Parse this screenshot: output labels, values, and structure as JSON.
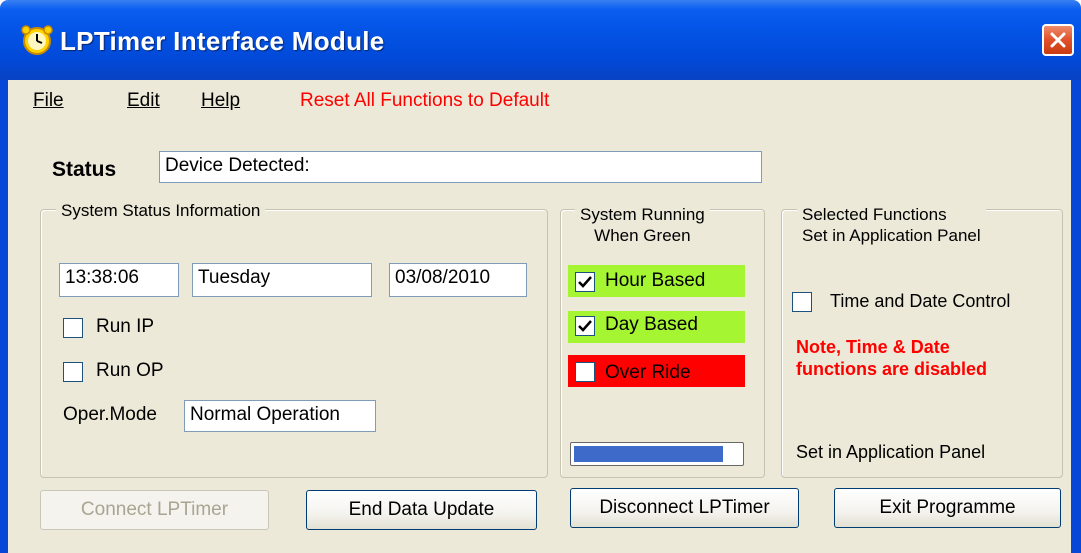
{
  "window": {
    "title": "LPTimer Interface Module"
  },
  "menu": {
    "file": "File",
    "edit": "Edit",
    "help": "Help",
    "reset": "Reset All Functions to Default"
  },
  "status": {
    "label": "Status",
    "value": "Device Detected:"
  },
  "system_status": {
    "title": "System Status Information",
    "time": "13:38:06",
    "day": "Tuesday",
    "date": "03/08/2010",
    "run_ip": {
      "label": "Run IP",
      "checked": false
    },
    "run_op": {
      "label": "Run OP",
      "checked": false
    },
    "oper_mode_label": "Oper.Mode",
    "oper_mode_value": "Normal Operation"
  },
  "system_running": {
    "title_line1": "System Running",
    "title_line2": "When Green",
    "hour_based": {
      "label": "Hour Based",
      "checked": true,
      "color": "#a6f532"
    },
    "day_based": {
      "label": "Day Based",
      "checked": true,
      "color": "#a6f532"
    },
    "over_ride": {
      "label": "Over Ride",
      "checked": false,
      "color": "#ff0000"
    },
    "progress": 0.9
  },
  "selected_functions": {
    "title_line1": "Selected Functions",
    "title_line2": "Set in Application Panel",
    "time_date_control": {
      "label": "Time and Date Control",
      "checked": false
    },
    "note_line1": "Note, Time & Date",
    "note_line2": "functions are disabled",
    "footer": "Set in Application Panel"
  },
  "buttons": {
    "connect": "Connect LPTimer",
    "end_update": "End Data Update",
    "disconnect": "Disconnect LPTimer",
    "exit": "Exit Programme"
  },
  "icons": {
    "app": "clock-icon",
    "close": "close-icon",
    "check": "checkmark-icon"
  },
  "colors": {
    "title_bar": "#0353e5",
    "reset_text": "#ff0000",
    "note_text": "#ff0000",
    "progress": "#3e6ac9"
  }
}
